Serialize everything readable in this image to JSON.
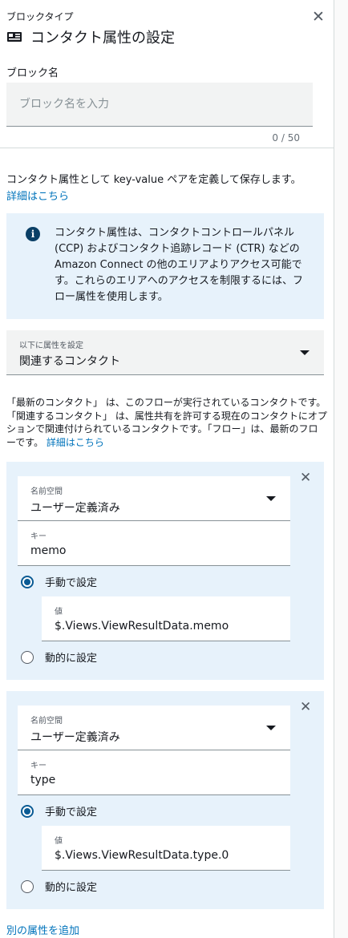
{
  "header": {
    "block_type_label": "ブロックタイプ",
    "title": "コンタクト属性の設定",
    "close_icon": "close-icon",
    "title_icon": "contact-block-icon"
  },
  "block_name": {
    "label": "ブロック名",
    "placeholder": "ブロック名を入力",
    "value": "",
    "counter": "0 / 50"
  },
  "description": {
    "text": "コンタクト属性として key-value ペアを定義して保存します。",
    "link": "詳細はこちら"
  },
  "info": {
    "icon": "info-icon",
    "text": "コンタクト属性は、コンタクトコントロールパネル (CCP) およびコンタクト追跡レコード (CTR) などの Amazon Connect の他のエリアよりアクセス可能です。これらのエリアへのアクセスを制限するには、フロー属性を使用します。"
  },
  "target_select": {
    "label": "以下に属性を設定",
    "value": "関連するコンタクト"
  },
  "explanation": {
    "text": "「最新のコンタクト」 は、このフローが実行されているコンタクトです。「関連するコンタクト」 は、属性共有を許可する現在のコンタクトにオプションで関連付けられているコンタクトです。「フロー」は、最新のフローです。",
    "link": "詳細はこちら"
  },
  "attributes": [
    {
      "namespace_label": "名前空間",
      "namespace_value": "ユーザー定義済み",
      "key_label": "キー",
      "key_value": "memo",
      "manual_label": "手動で設定",
      "manual_selected": true,
      "value_label": "値",
      "value": "$.Views.ViewResultData.memo",
      "dynamic_label": "動的に設定"
    },
    {
      "namespace_label": "名前空間",
      "namespace_value": "ユーザー定義済み",
      "key_label": "キー",
      "key_value": "type",
      "manual_label": "手動で設定",
      "manual_selected": true,
      "value_label": "値",
      "value": "$.Views.ViewResultData.type.0",
      "dynamic_label": "動的に設定"
    }
  ],
  "footer": {
    "add_link": "別の属性を追加"
  }
}
